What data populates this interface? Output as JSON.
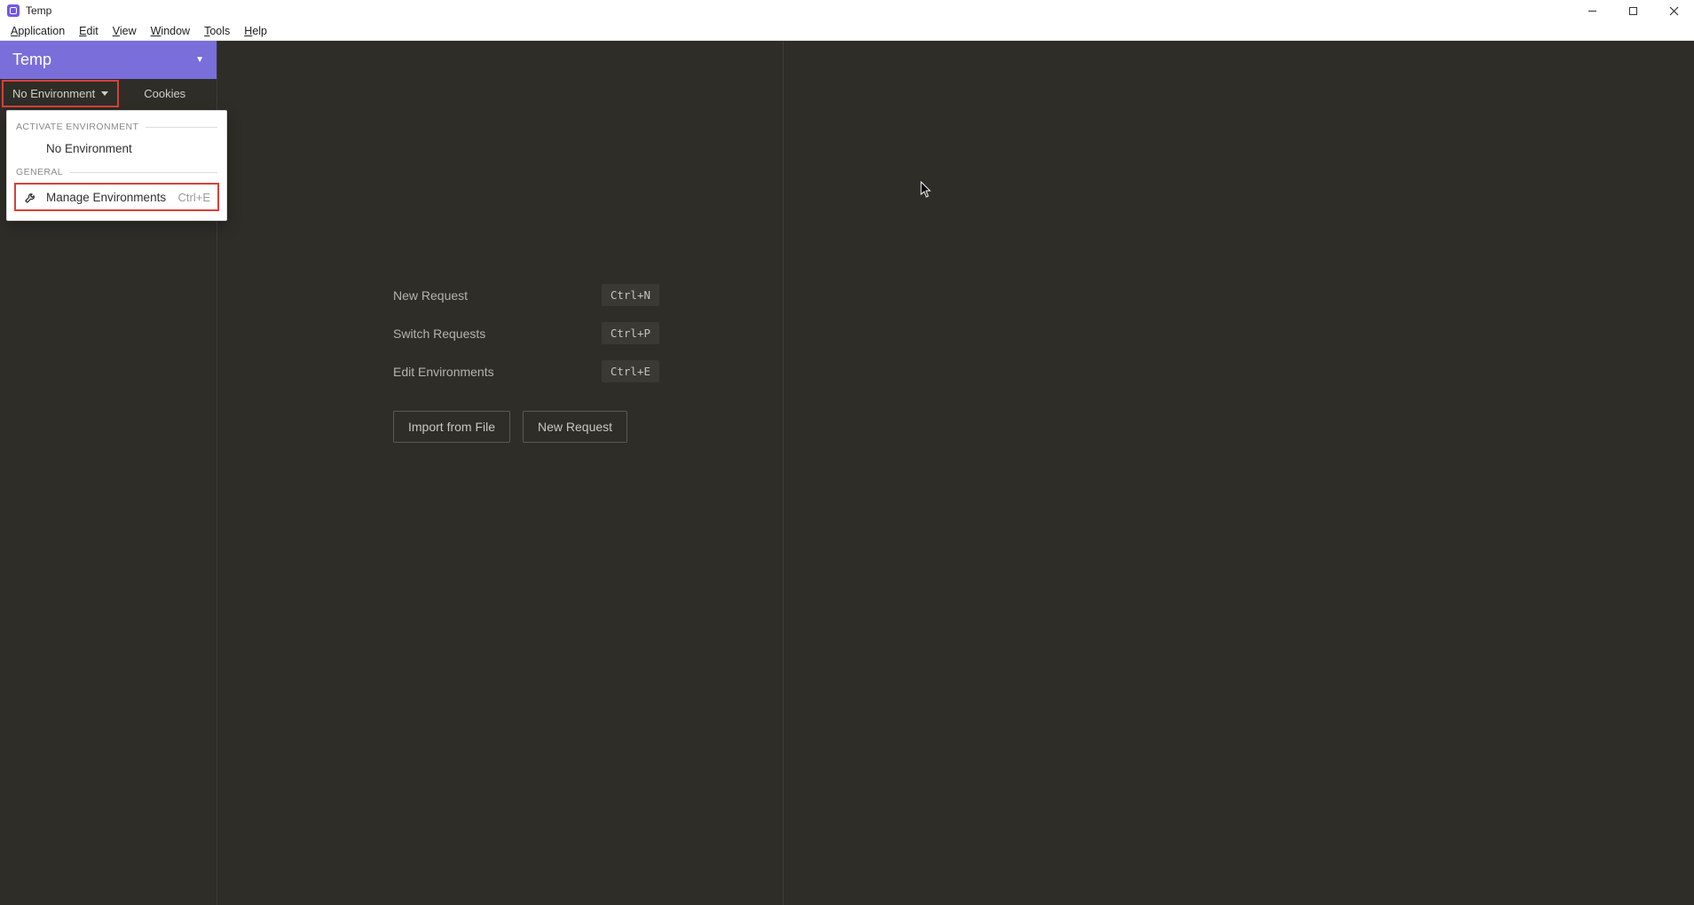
{
  "titlebar": {
    "title": "Temp"
  },
  "menubar": {
    "items": [
      "Application",
      "Edit",
      "View",
      "Window",
      "Tools",
      "Help"
    ]
  },
  "workspace": {
    "name": "Temp"
  },
  "toolbar": {
    "environment_label": "No Environment",
    "cookies_label": "Cookies"
  },
  "env_dropdown": {
    "section_activate": "ACTIVATE ENVIRONMENT",
    "no_environment": "No Environment",
    "section_general": "GENERAL",
    "manage_label": "Manage Environments",
    "manage_shortcut": "Ctrl+E"
  },
  "welcome": {
    "rows": [
      {
        "label": "New Request",
        "shortcut": "Ctrl+N"
      },
      {
        "label": "Switch Requests",
        "shortcut": "Ctrl+P"
      },
      {
        "label": "Edit Environments",
        "shortcut": "Ctrl+E"
      }
    ],
    "import_button": "Import from File",
    "new_request_button": "New Request"
  }
}
